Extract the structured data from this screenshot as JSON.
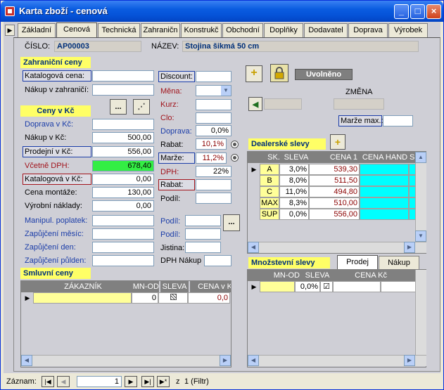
{
  "window": {
    "title": "Karta zboží - cenová",
    "min": "_",
    "max": "□",
    "close": "×"
  },
  "tabs": [
    {
      "label": "Základní"
    },
    {
      "label": "Cenová"
    },
    {
      "label": "Technická"
    },
    {
      "label": "Zahraničn"
    },
    {
      "label": "Konstrukč"
    },
    {
      "label": "Obchodní"
    },
    {
      "label": "Doplňky"
    },
    {
      "label": "Dodavatel"
    },
    {
      "label": "Doprava"
    },
    {
      "label": "Výrobek"
    }
  ],
  "header": {
    "cislo_label": "ČÍSLO:",
    "cislo_value": "AP00003",
    "nazev_label": "NÁZEV:",
    "nazev_value": "Stojina šikmá 50 cm"
  },
  "zahranicni": {
    "title": "Zahraniční ceny",
    "katalogova_label": "Katalogová cena:",
    "katalogova_value": "",
    "nakup_label": "Nákup v zahraničí:",
    "nakup_value": ""
  },
  "ceny": {
    "title": "Ceny v Kč",
    "doprava_label": "Doprava v Kč:",
    "doprava_value": "",
    "nakup_label": "Nákup v Kč:",
    "nakup_value": "500,00",
    "prodejni_label": "Prodejní v Kč:",
    "prodejni_value": "556,00",
    "vcetne_label": "Včetně DPH:",
    "vcetne_value": "678,40",
    "katalogova_label": "Katalogová v Kč:",
    "katalogova_value": "0,00",
    "montaz_label": "Cena montáže:",
    "montaz_value": "130,00",
    "vyrobni_label": "Výrobní náklady:",
    "vyrobni_value": "0,00",
    "manipul_label": "Manipul. poplatek:",
    "manipul_value": "",
    "mesic_label": "Zapůjčení měsíc:",
    "mesic_value": "",
    "den_label": "Zapůjčení den:",
    "den_value": "",
    "pulden_label": "Zapůjčení půlden:",
    "pulden_value": ""
  },
  "mid": {
    "discount_label": "Discount:",
    "discount_value": "",
    "mena_label": "Měna:",
    "mena_value": "",
    "kurz_label": "Kurz:",
    "kurz_value": "",
    "clo_label": "Clo:",
    "clo_value": "",
    "doprava_label": "Doprava:",
    "doprava_value": "0,0%",
    "rabat_label": "Rabat:",
    "rabat_value": "10,1%",
    "marze_label": "Marže:",
    "marze_value": "11,2%",
    "dph_label": "DPH:",
    "dph_value": "22%",
    "rabat2_label": "Rabat:",
    "rabat2_value": "",
    "podil_label": "Podíl:",
    "podil_value": "",
    "podil2_label": "Podíl:",
    "podil2_value": "",
    "podil3_label": "Podíl:",
    "podil3_value": "",
    "jistina_label": "Jistina:",
    "jistina_value": "",
    "dph_nakup_label": "DPH Nákup",
    "dph_nakup_value": "",
    "dots": "..."
  },
  "right": {
    "status_text": "Uvolněno",
    "zmena_label": "ZMĚNA",
    "marze_max_label": "Marže max.:",
    "marze_max_value": "",
    "plus": "+"
  },
  "dealer": {
    "title": "Dealerské slevy",
    "columns": [
      "SK.",
      "SLEVA",
      "CENA 1",
      "CENA HAND",
      "S"
    ],
    "rows": [
      {
        "sk": "A",
        "sleva": "3,0%",
        "cena1": "539,30"
      },
      {
        "sk": "B",
        "sleva": "8,0%",
        "cena1": "511,50"
      },
      {
        "sk": "C",
        "sleva": "11,0%",
        "cena1": "494,80"
      },
      {
        "sk": "MAX",
        "sleva": "8,3%",
        "cena1": "510,00"
      },
      {
        "sk": "SUP",
        "sleva": "0,0%",
        "cena1": "556,00"
      }
    ]
  },
  "smluvni": {
    "title": "Smluvní ceny",
    "columns": [
      "ZÁKAZNÍK",
      "MN-OD",
      "SLEVA",
      "CENA v K"
    ],
    "row": {
      "zakaznik": "",
      "mnod": "0",
      "sleva": "",
      "cena": "0,0"
    }
  },
  "mnozstevni": {
    "title": "Množstevní slevy",
    "tab_prodej": "Prodej",
    "tab_nakup": "Nákup",
    "columns": [
      "MN-OD",
      "SLEVA",
      "CENA Kč",
      "CE"
    ],
    "row": {
      "mnod": "",
      "sleva": "0,0%",
      "cena": ""
    }
  },
  "status": {
    "zaznam_label": "Záznam:",
    "record": "1",
    "of_label": "z",
    "count": "1 (Filtr)"
  }
}
